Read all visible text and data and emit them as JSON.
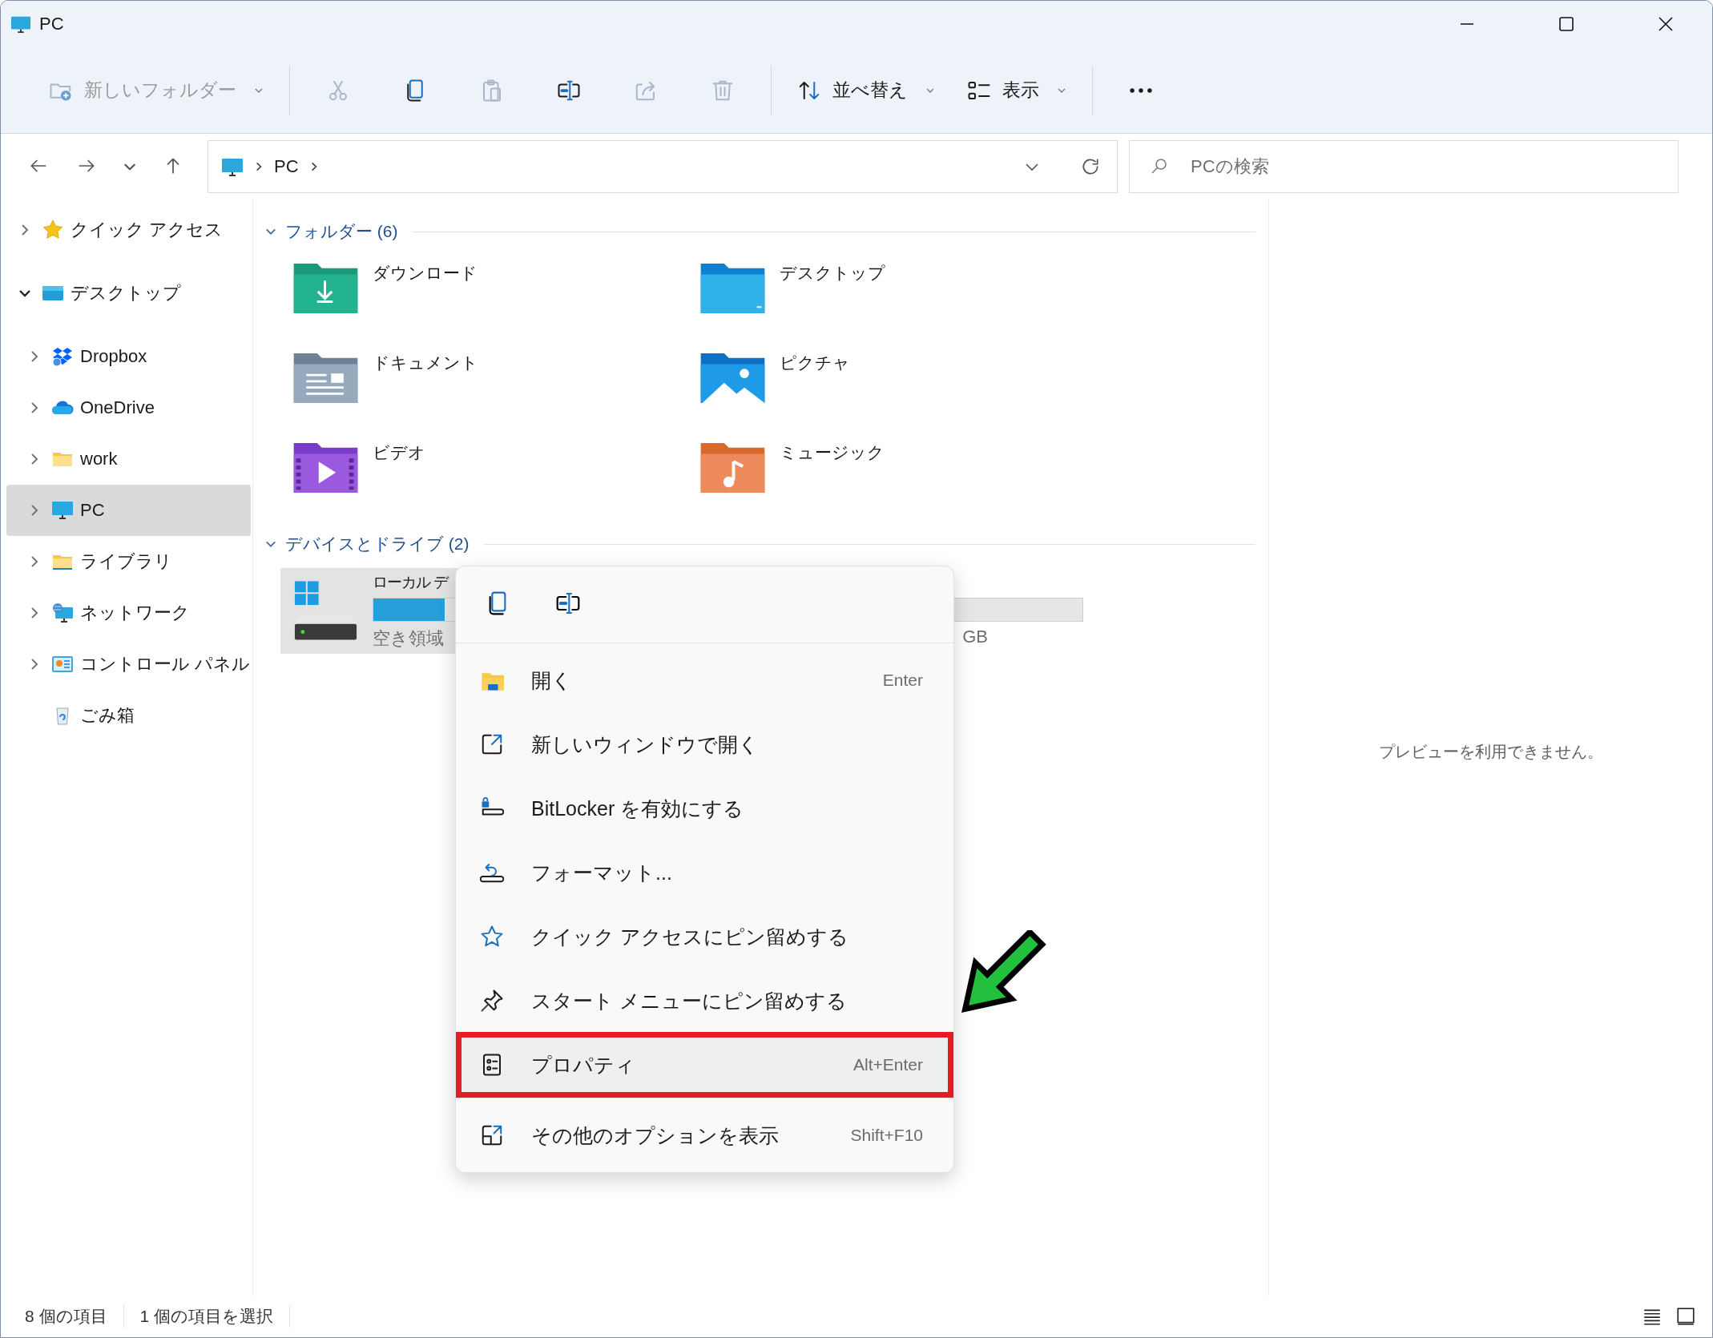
{
  "window": {
    "title": "PC"
  },
  "toolbar": {
    "items": [
      {
        "kind": "new_folder",
        "label": "新しいフォルダー",
        "disabled": true,
        "dropdown": true
      },
      {
        "kind": "separator"
      },
      {
        "kind": "cut",
        "disabled": true
      },
      {
        "kind": "copy",
        "disabled": false
      },
      {
        "kind": "paste",
        "disabled": true
      },
      {
        "kind": "rename",
        "disabled": false
      },
      {
        "kind": "share",
        "disabled": true
      },
      {
        "kind": "delete",
        "disabled": true
      },
      {
        "kind": "separator"
      },
      {
        "kind": "sort",
        "label": "並べ替え",
        "disabled": false,
        "dropdown": true
      },
      {
        "kind": "view",
        "label": "表示",
        "disabled": false,
        "dropdown": true
      },
      {
        "kind": "separator"
      },
      {
        "kind": "more",
        "disabled": false
      }
    ]
  },
  "address_bar": {
    "segments": [
      "PC"
    ]
  },
  "search": {
    "placeholder": "PCの検索"
  },
  "sidebar": {
    "items": [
      {
        "kind": "quick_access",
        "label": "クイック アクセス",
        "expanded": false,
        "selected": false
      },
      {
        "kind": "desktop",
        "label": "デスクトップ",
        "expanded": true,
        "selected": false,
        "children": [
          {
            "kind": "dropbox",
            "label": "Dropbox",
            "expanded": false,
            "selected": false
          },
          {
            "kind": "onedrive",
            "label": "OneDrive",
            "expanded": false,
            "selected": false
          },
          {
            "kind": "folder",
            "label": "work",
            "expanded": false,
            "selected": false
          },
          {
            "kind": "pc",
            "label": "PC",
            "expanded": false,
            "selected": true
          },
          {
            "kind": "library",
            "label": "ライブラリ",
            "expanded": false,
            "selected": false
          },
          {
            "kind": "network",
            "label": "ネットワーク",
            "expanded": false,
            "selected": false
          },
          {
            "kind": "control_panel",
            "label": "コントロール パネル",
            "expanded": false,
            "selected": false
          },
          {
            "kind": "recycle_bin",
            "label": "ごみ箱",
            "selected": false
          }
        ]
      }
    ]
  },
  "content": {
    "sections": [
      {
        "kind": "folders",
        "title": "フォルダー (6)",
        "expanded": true,
        "items": [
          {
            "kind": "downloads",
            "label": "ダウンロード"
          },
          {
            "kind": "desktop",
            "label": "デスクトップ"
          },
          {
            "kind": "documents",
            "label": "ドキュメント"
          },
          {
            "kind": "pictures",
            "label": "ピクチャ"
          },
          {
            "kind": "videos",
            "label": "ビデオ"
          },
          {
            "kind": "music",
            "label": "ミュージック"
          }
        ]
      },
      {
        "kind": "drives",
        "title": "デバイスとドライブ (2)",
        "expanded": true,
        "items": [
          {
            "name": "ローカル デ",
            "level": 0.1,
            "free": "空き領域",
            "size": "GB",
            "selected": true
          }
        ]
      }
    ]
  },
  "preview": {
    "message": "プレビューを利用できません。"
  },
  "context_menu": {
    "quick_actions": [
      {
        "kind": "copy"
      },
      {
        "kind": "rename"
      }
    ],
    "groups": [
      [
        {
          "kind": "open",
          "label": "開く",
          "shortcut": "Enter",
          "highlighted": false,
          "annotated": false
        },
        {
          "kind": "new_window",
          "label": "新しいウィンドウで開く",
          "highlighted": false,
          "annotated": false
        },
        {
          "kind": "bitlocker",
          "label": "BitLocker を有効にする",
          "highlighted": false,
          "annotated": false
        },
        {
          "kind": "format",
          "label": "フォーマット...",
          "highlighted": false,
          "annotated": false
        },
        {
          "kind": "pin_quick",
          "label": "クイック アクセスにピン留めする",
          "highlighted": false,
          "annotated": false
        },
        {
          "kind": "pin_start",
          "label": "スタート メニューにピン留めする",
          "highlighted": false,
          "annotated": false
        },
        {
          "kind": "properties",
          "label": "プロパティ",
          "shortcut": "Alt+Enter",
          "highlighted": true,
          "annotated": true
        }
      ],
      [
        {
          "kind": "more_options",
          "label": "その他のオプションを表示",
          "shortcut": "Shift+F10",
          "highlighted": false,
          "annotated": false
        }
      ]
    ]
  },
  "status_bar": {
    "items": [
      "8 個の項目",
      "1 個の項目を選択"
    ],
    "views": [
      {
        "kind": "details"
      },
      {
        "kind": "tiles"
      }
    ]
  }
}
